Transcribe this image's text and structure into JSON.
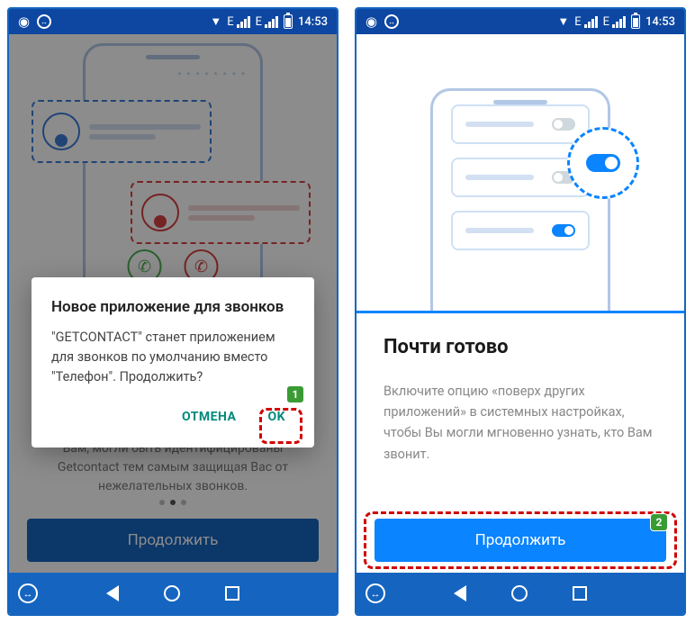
{
  "status_bar": {
    "signal_label": "E",
    "time_left": "14:53",
    "time_right": "14:53"
  },
  "left_screen": {
    "background_text": "Вам, могли быть идентифицированы Getcontact тем самым защищая Вас от нежелательных звонков.",
    "continue_button": "Продолжить",
    "dialog": {
      "title": "Новое приложение для звонков",
      "body": "\"GETCONTACT\" станет приложением для звонков по умолчанию вместо \"Телефон\". Продолжить?",
      "cancel": "ОТМЕНА",
      "ok": "OK"
    }
  },
  "right_screen": {
    "heading": "Почти готово",
    "description": "Включите опцию «поверх других приложений» в системных настройках, чтобы Вы могли мгновенно узнать, кто Вам звонит.",
    "continue_button": "Продолжить"
  },
  "annotations": {
    "badge1": "1",
    "badge2": "2"
  }
}
